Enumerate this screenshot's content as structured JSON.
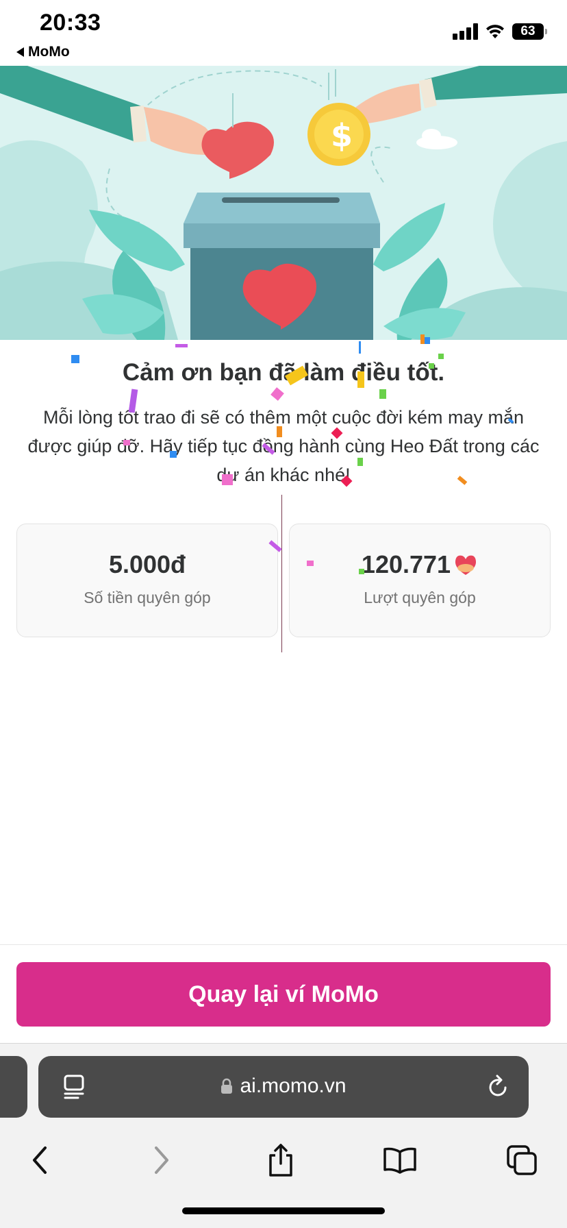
{
  "status_bar": {
    "time": "20:33",
    "back_label": "MoMo",
    "battery": "63"
  },
  "content": {
    "title": "Cảm ơn bạn đã làm điều tốt.",
    "description": "Mỗi lòng tốt trao đi sẽ có thêm một cuộc đời kém may mắn được giúp đỡ. Hãy tiếp tục đồng hành cùng Heo Đất trong các dự án khác nhé!"
  },
  "stats": {
    "amount_value": "5.000đ",
    "amount_label": "Số tiền quyên góp",
    "count_value": "120.771",
    "count_label": "Lượt quyên góp"
  },
  "cta_label": "Quay lại ví MoMo",
  "browser": {
    "url": "ai.momo.vn"
  },
  "colors": {
    "brand": "#d82d8b",
    "hero_bg": "#dcf3f1",
    "text": "#303233"
  }
}
